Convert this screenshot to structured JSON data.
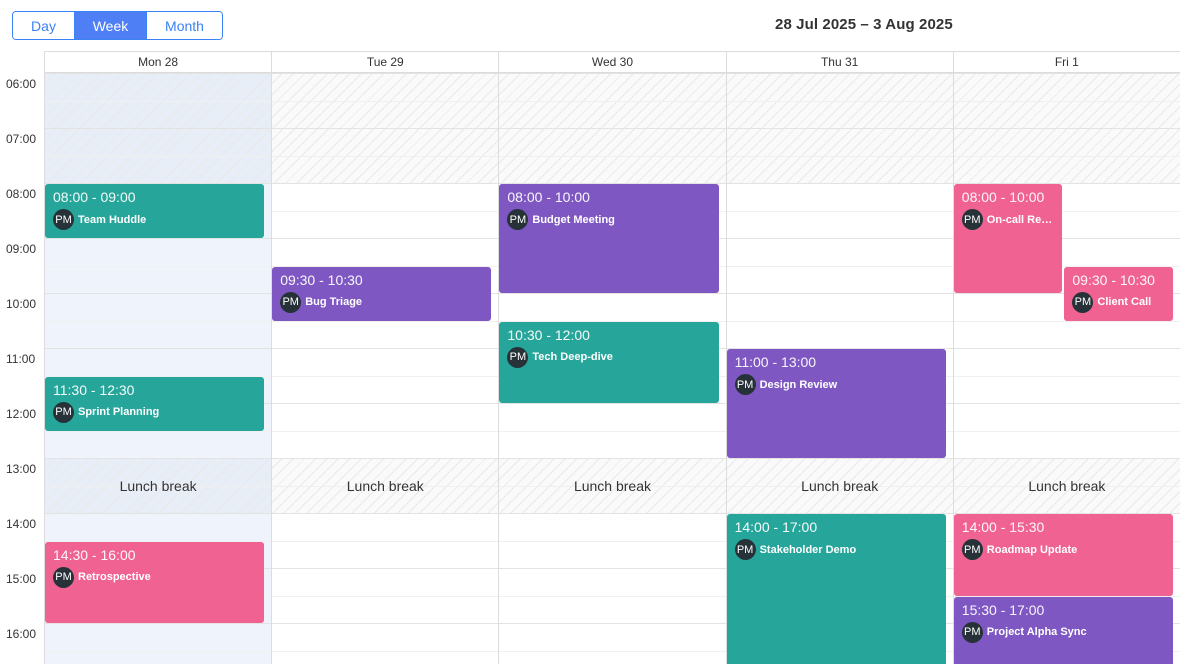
{
  "toolbar": {
    "views": [
      {
        "label": "Day",
        "active": false
      },
      {
        "label": "Week",
        "active": true
      },
      {
        "label": "Month",
        "active": false
      }
    ]
  },
  "range_title": "28 Jul 2025 – 3 Aug 2025",
  "days": [
    {
      "label": "Mon 28",
      "today": true
    },
    {
      "label": "Tue 29",
      "today": false
    },
    {
      "label": "Wed 30",
      "today": false
    },
    {
      "label": "Thu 31",
      "today": false
    },
    {
      "label": "Fri 1",
      "today": false
    }
  ],
  "hours": [
    "06:00",
    "07:00",
    "08:00",
    "09:00",
    "10:00",
    "11:00",
    "12:00",
    "13:00",
    "14:00",
    "15:00",
    "16:00"
  ],
  "grid_start_hour": 6,
  "working_start_hour": 8,
  "lunch": {
    "start": 13,
    "end": 14,
    "label": "Lunch break"
  },
  "avatar_label": "PM",
  "colors": {
    "teal": "#26a69a",
    "purple": "#7e57c2",
    "pink": "#f06292",
    "accent": "#4f7ff5"
  },
  "events": [
    {
      "day": 0,
      "start": 8,
      "end": 9,
      "time": "08:00 - 09:00",
      "title": "Team Huddle",
      "color": "teal",
      "lane": 0,
      "lanes": 1
    },
    {
      "day": 0,
      "start": 11.5,
      "end": 12.5,
      "time": "11:30 - 12:30",
      "title": "Sprint Planning",
      "color": "teal",
      "lane": 0,
      "lanes": 1
    },
    {
      "day": 0,
      "start": 14.5,
      "end": 16,
      "time": "14:30 - 16:00",
      "title": "Retrospective",
      "color": "pink",
      "lane": 0,
      "lanes": 1
    },
    {
      "day": 1,
      "start": 9.5,
      "end": 10.5,
      "time": "09:30 - 10:30",
      "title": "Bug Triage",
      "color": "purple",
      "lane": 0,
      "lanes": 1
    },
    {
      "day": 2,
      "start": 8,
      "end": 10,
      "time": "08:00 - 10:00",
      "title": "Budget Meeting",
      "color": "purple",
      "lane": 0,
      "lanes": 1
    },
    {
      "day": 2,
      "start": 10.5,
      "end": 12,
      "time": "10:30 - 12:00",
      "title": "Tech Deep-dive",
      "color": "teal",
      "lane": 0,
      "lanes": 1
    },
    {
      "day": 3,
      "start": 11,
      "end": 13,
      "time": "11:00 - 13:00",
      "title": "Design Review",
      "color": "purple",
      "lane": 0,
      "lanes": 1
    },
    {
      "day": 3,
      "start": 14,
      "end": 17,
      "time": "14:00 - 17:00",
      "title": "Stakeholder Demo",
      "color": "teal",
      "lane": 0,
      "lanes": 1
    },
    {
      "day": 4,
      "start": 8,
      "end": 10,
      "time": "08:00 - 10:00",
      "title": "On-call Review",
      "color": "pink",
      "lane": 0,
      "lanes": 2
    },
    {
      "day": 4,
      "start": 9.5,
      "end": 10.5,
      "time": "09:30 - 10:30",
      "title": "Client Call",
      "color": "pink",
      "lane": 1,
      "lanes": 2
    },
    {
      "day": 4,
      "start": 14,
      "end": 15.5,
      "time": "14:00 - 15:30",
      "title": "Roadmap Update",
      "color": "pink",
      "lane": 0,
      "lanes": 1
    },
    {
      "day": 4,
      "start": 15.5,
      "end": 17,
      "time": "15:30 - 17:00",
      "title": "Project Alpha Sync",
      "color": "purple",
      "lane": 0,
      "lanes": 1
    }
  ]
}
